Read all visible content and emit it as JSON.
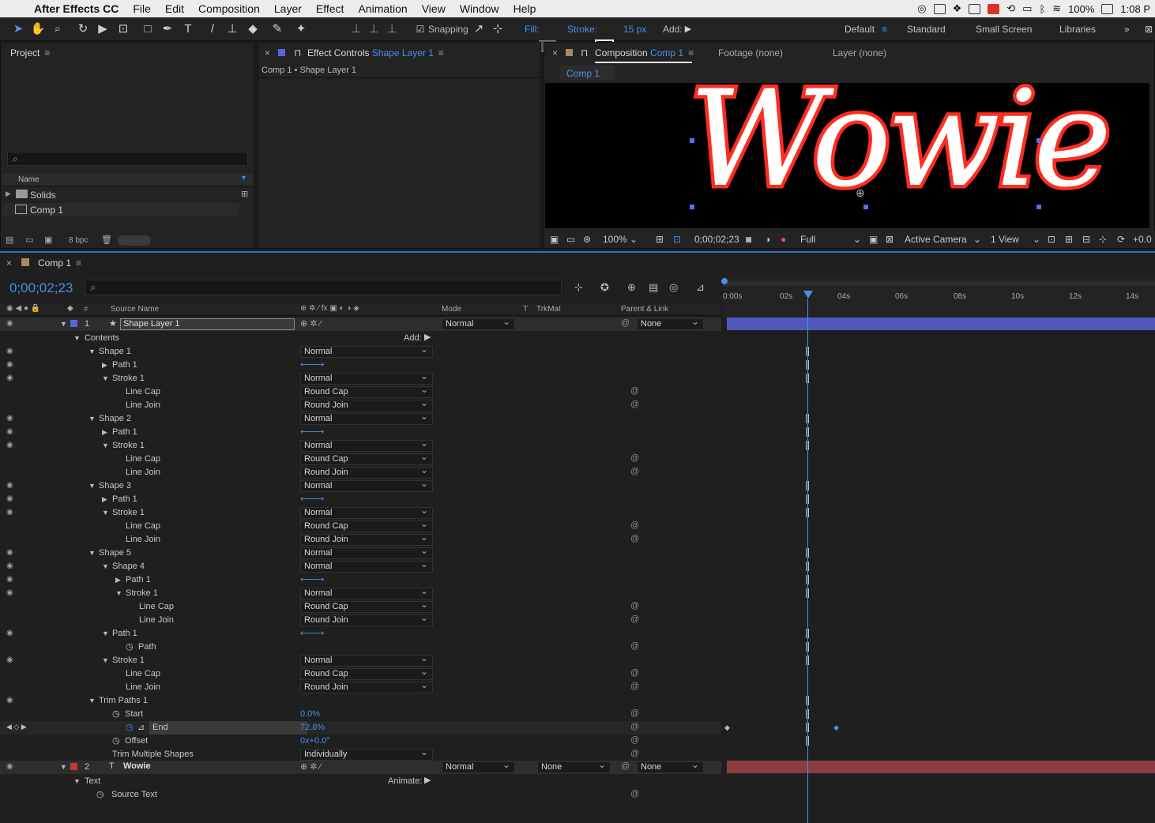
{
  "menubar": {
    "apple": "",
    "items": [
      "After Effects CC",
      "File",
      "Edit",
      "Composition",
      "Layer",
      "Effect",
      "Animation",
      "View",
      "Window",
      "Help"
    ],
    "battery": "100%",
    "clock": "1:08 P"
  },
  "toolbar": {
    "snapping": "Snapping",
    "fill_label": "Fill:",
    "stroke_label": "Stroke:",
    "stroke_width": "15 px",
    "add_label": "Add:",
    "workspaces": [
      "Default",
      "Standard",
      "Small Screen",
      "Libraries"
    ]
  },
  "project_panel": {
    "title": "Project",
    "search_icon": "⌕",
    "column_name": "Name",
    "items": [
      "Solids",
      "Comp 1"
    ],
    "bpc": "8 bpc"
  },
  "effect_controls": {
    "title_prefix": "Effect Controls",
    "title_layer": "Shape Layer 1",
    "breadcrumb": "Comp 1 • Shape Layer 1"
  },
  "composition_panel": {
    "title_prefix": "Composition",
    "title_comp": "Comp 1",
    "footage": "Footage (none)",
    "layer": "Layer (none)",
    "tab": "Comp 1",
    "canvas_text": "Wowie",
    "zoom": "100%",
    "timecode": "0;00;02;23",
    "resolution": "Full",
    "camera": "Active Camera",
    "views": "1 View",
    "exposure": "+0.0"
  },
  "timeline": {
    "tab": "Comp 1",
    "timecode": "0;00;02;23",
    "columns": {
      "source_name": "Source Name",
      "mode": "Mode",
      "t": "T",
      "trkmat": "TrkMat",
      "parent": "Parent & Link"
    },
    "ruler": [
      "0:00s",
      "02s",
      "04s",
      "06s",
      "08s",
      "10s",
      "12s",
      "14s"
    ],
    "layers": [
      {
        "index": "1",
        "name": "Shape Layer 1",
        "mode": "Normal",
        "parent": "None",
        "color": "#5b63d8"
      },
      {
        "index": "2",
        "name": "Wowie",
        "mode": "Normal",
        "trkmat": "None",
        "parent": "None",
        "color": "#c2373a"
      }
    ],
    "contents_label": "Contents",
    "add_label": "Add:",
    "animate_label": "Animate:",
    "rows": [
      {
        "label": "Shape 1",
        "value": "Normal"
      },
      {
        "label": "Path 1",
        "value": ""
      },
      {
        "label": "Stroke 1",
        "value": "Normal"
      },
      {
        "label": "Line Cap",
        "value": "Round Cap"
      },
      {
        "label": "Line Join",
        "value": "Round Join"
      },
      {
        "label": "Shape 2",
        "value": "Normal"
      },
      {
        "label": "Path 1",
        "value": ""
      },
      {
        "label": "Stroke 1",
        "value": "Normal"
      },
      {
        "label": "Line Cap",
        "value": "Round Cap"
      },
      {
        "label": "Line Join",
        "value": "Round Join"
      },
      {
        "label": "Shape 3",
        "value": "Normal"
      },
      {
        "label": "Path 1",
        "value": ""
      },
      {
        "label": "Stroke 1",
        "value": "Normal"
      },
      {
        "label": "Line Cap",
        "value": "Round Cap"
      },
      {
        "label": "Line Join",
        "value": "Round Join"
      },
      {
        "label": "Shape 5",
        "value": "Normal"
      },
      {
        "label": "Shape 4",
        "value": "Normal"
      },
      {
        "label": "Path 1",
        "value": ""
      },
      {
        "label": "Stroke 1",
        "value": "Normal"
      },
      {
        "label": "Line Cap",
        "value": "Round Cap"
      },
      {
        "label": "Line Join",
        "value": "Round Join"
      },
      {
        "label": "Path 1",
        "value": ""
      },
      {
        "label": "Path",
        "value": ""
      },
      {
        "label": "Stroke 1",
        "value": "Normal"
      },
      {
        "label": "Line Cap",
        "value": "Round Cap"
      },
      {
        "label": "Line Join",
        "value": "Round Join"
      },
      {
        "label": "Trim Paths 1",
        "value": ""
      },
      {
        "label": "Start",
        "value": "0.0%"
      },
      {
        "label": "End",
        "value": "72.8%"
      },
      {
        "label": "Offset",
        "value": "0x+0.0°"
      },
      {
        "label": "Trim Multiple Shapes",
        "value": "Individually"
      }
    ],
    "text_group": "Text",
    "source_text": "Source Text"
  }
}
